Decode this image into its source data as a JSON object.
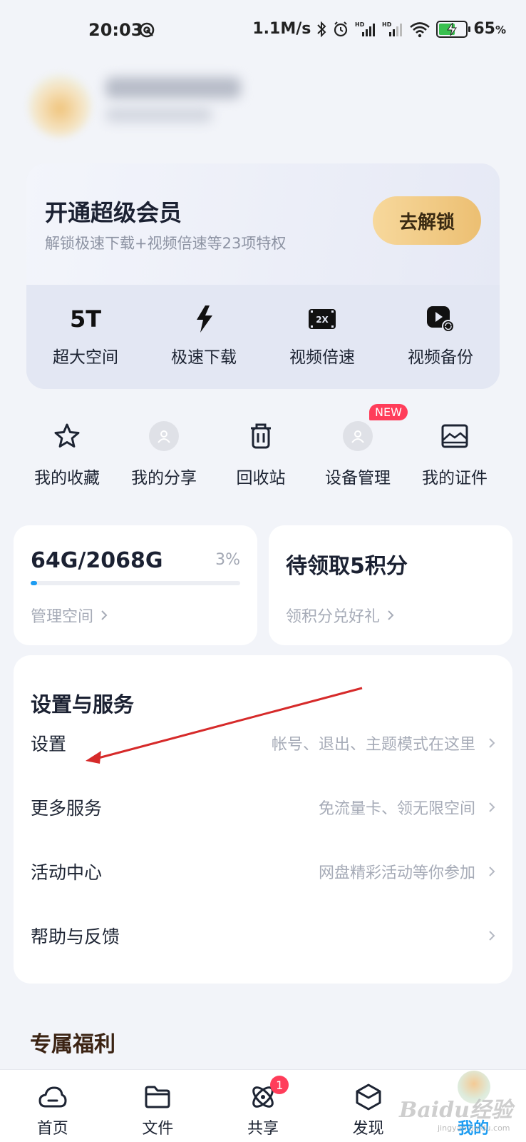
{
  "status_bar": {
    "time": "20:03",
    "network_speed": "1.1M/s",
    "battery_percent": "65",
    "battery_level": 0.65,
    "icons": [
      "hotspot-icon",
      "bluetooth-icon",
      "alarm-icon",
      "signal-hd-icon",
      "signal-hd-icon",
      "wifi-icon",
      "battery-charging-icon"
    ]
  },
  "vip": {
    "title": "开通超级会员",
    "subtitle": "解锁极速下载+视频倍速等23项特权",
    "unlock_label": "去解锁",
    "perks": [
      {
        "icon": "5t-text",
        "icon_text": "5T",
        "label": "超大空间"
      },
      {
        "icon": "lightning-icon",
        "label": "极速下载"
      },
      {
        "icon": "speed-2x-icon",
        "icon_text": "2X",
        "label": "视频倍速"
      },
      {
        "icon": "video-backup-icon",
        "label": "视频备份"
      }
    ]
  },
  "shortcuts": [
    {
      "icon": "star-icon",
      "label": "我的收藏"
    },
    {
      "icon": "avatar-placeholder-icon",
      "label": "我的分享"
    },
    {
      "icon": "trash-icon",
      "label": "回收站"
    },
    {
      "icon": "avatar-placeholder-icon",
      "label": "设备管理",
      "badge": "NEW"
    },
    {
      "icon": "id-card-icon",
      "label": "我的证件"
    }
  ],
  "storage": {
    "used_total": "64G/2068G",
    "percent_label": "3%",
    "percent_value": 3,
    "link": "管理空间"
  },
  "points": {
    "title": "待领取5积分",
    "link": "领积分兑好礼"
  },
  "settings": {
    "title": "设置与服务",
    "rows": [
      {
        "label": "设置",
        "desc": "帐号、退出、主题模式在这里"
      },
      {
        "label": "更多服务",
        "desc": "免流量卡、领无限空间"
      },
      {
        "label": "活动中心",
        "desc": "网盘精彩活动等你参加"
      },
      {
        "label": "帮助与反馈",
        "desc": ""
      }
    ]
  },
  "exclusive_title": "专属福利",
  "annotation_color": "#d62a2a",
  "accent_color": "#1c9cf2",
  "bottom_nav": [
    {
      "icon": "cloud-icon",
      "label": "首页"
    },
    {
      "icon": "folder-icon",
      "label": "文件"
    },
    {
      "icon": "atom-share-icon",
      "label": "共享",
      "badge": "1"
    },
    {
      "icon": "cube-icon",
      "label": "发现"
    },
    {
      "icon": "profile-icon",
      "label": "我的",
      "active": true
    }
  ],
  "watermark": {
    "text": "Baidu经验",
    "sub": "jingyan.baidu.com"
  }
}
